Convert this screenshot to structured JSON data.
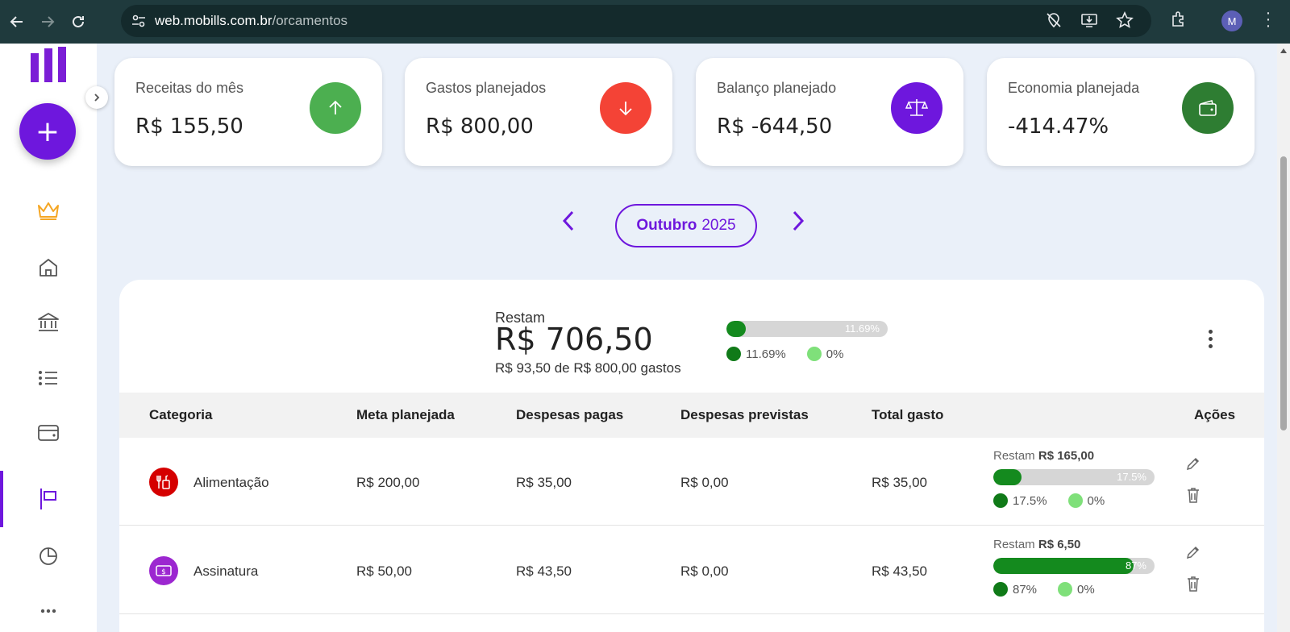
{
  "browser": {
    "url_host": "web.mobills.com.br",
    "url_path": "/orcamentos",
    "profile_initial": "M"
  },
  "sidebar": {
    "fab_label": "+",
    "icons": [
      "crown-icon",
      "home-icon",
      "bank-icon",
      "list-icon",
      "card-icon",
      "flag-icon",
      "pie-chart-icon",
      "more-icon"
    ],
    "active_item": "flag-icon"
  },
  "summary": [
    {
      "label": "Receitas do mês",
      "value": "R$ 155,50",
      "color": "#4caf50",
      "icon": "arrow-up-icon"
    },
    {
      "label": "Gastos planejados",
      "value": "R$ 800,00",
      "color": "#f44336",
      "icon": "arrow-down-icon"
    },
    {
      "label": "Balanço planejado",
      "value": "R$ -644,50",
      "color": "#6e17dd",
      "icon": "scale-icon"
    },
    {
      "label": "Economia planejada",
      "value": "-414.47%",
      "color": "#2e7d32",
      "icon": "wallet-icon"
    }
  ],
  "month": {
    "name": "Outubro",
    "year": "2025"
  },
  "overview": {
    "label": "Restam",
    "value": "R$ 706,50",
    "subtitle": "R$ 93,50 de R$ 800,00 gastos",
    "progress": 0.1169,
    "progress_label": "11.69%",
    "legend_paid": "11.69%",
    "legend_planned": "0%"
  },
  "table": {
    "headers": {
      "categoria": "Categoria",
      "meta": "Meta planejada",
      "pagas": "Despesas pagas",
      "previstas": "Despesas previstas",
      "total": "Total gasto",
      "acoes": "Ações"
    },
    "rows": [
      {
        "name": "Alimentação",
        "icon": "food-icon",
        "color": "#d50000",
        "meta": "R$ 200,00",
        "pagas": "R$ 35,00",
        "previstas": "R$ 0,00",
        "total": "R$ 35,00",
        "restam_label": "Restam",
        "restam_value": "R$ 165,00",
        "progress": 0.175,
        "progress_label": "17.5%",
        "legend_paid": "17.5%",
        "legend_planned": "0%"
      },
      {
        "name": "Assinatura",
        "icon": "money-icon",
        "color": "#9c27d0",
        "meta": "R$ 50,00",
        "pagas": "R$ 43,50",
        "previstas": "R$ 0,00",
        "total": "R$ 43,50",
        "restam_label": "Restam",
        "restam_value": "R$ 6,50",
        "progress": 0.87,
        "progress_label": "87%",
        "legend_paid": "87%",
        "legend_planned": "0%"
      }
    ]
  }
}
